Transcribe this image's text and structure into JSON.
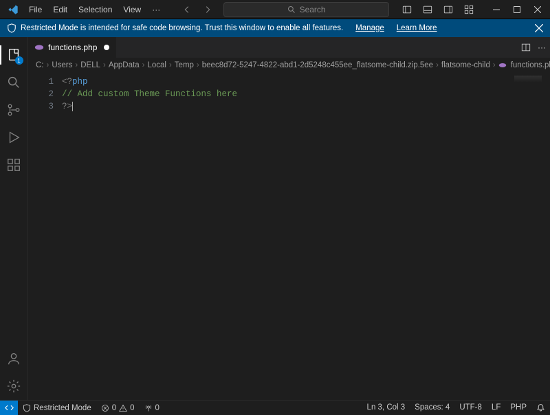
{
  "menubar": {
    "items": [
      "File",
      "Edit",
      "Selection",
      "View"
    ],
    "more": "···"
  },
  "search": {
    "placeholder": "Search"
  },
  "notification": {
    "message": "Restricted Mode is intended for safe code browsing. Trust this window to enable all features.",
    "manage": "Manage",
    "learn": "Learn More"
  },
  "activity": {
    "explorer_badge": "1"
  },
  "tabs": {
    "items": [
      {
        "label": "functions.php",
        "dirty": true
      }
    ]
  },
  "breadcrumb": {
    "segments": [
      "C:",
      "Users",
      "DELL",
      "AppData",
      "Local",
      "Temp",
      "beec8d72-5247-4822-abd1-2d5248c455ee_flatsome-child.zip.5ee",
      "flatsome-child"
    ],
    "file": "functions.php"
  },
  "code": {
    "lines": [
      {
        "n": "1",
        "html": "<span class='tok-tag'>&lt;?</span><span class='tok-keyword'>php</span>"
      },
      {
        "n": "2",
        "html": "<span class='tok-comment'>// Add custom Theme Functions here</span>"
      },
      {
        "n": "3",
        "html": "<span class='tok-tag'>?&gt;</span><span class='cursor'></span>"
      }
    ]
  },
  "statusbar": {
    "restricted": "Restricted Mode",
    "errors": "0",
    "warnings": "0",
    "ports": "0",
    "ln_col": "Ln 3, Col 3",
    "spaces": "Spaces: 4",
    "encoding": "UTF-8",
    "eol": "LF",
    "lang": "PHP"
  }
}
